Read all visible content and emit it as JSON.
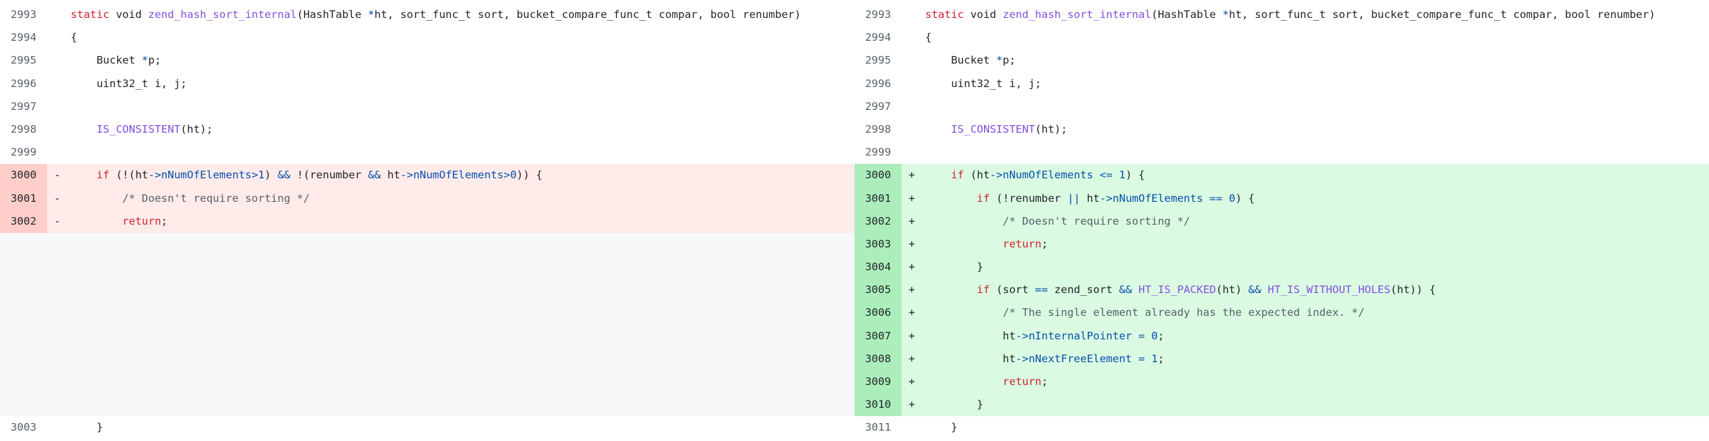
{
  "diff": {
    "left": [
      {
        "kind": "normal",
        "num": "2993",
        "mark": "",
        "tokens": [
          [
            "kw",
            "static"
          ],
          [
            "pl",
            " void "
          ],
          [
            "fn",
            "zend_hash_sort_internal"
          ],
          [
            "pl",
            "(HashTable "
          ],
          [
            "op",
            "*"
          ],
          [
            "pl",
            "ht, sort_func_t sort, bucket_compare_func_t compar, bool renumber)"
          ]
        ]
      },
      {
        "kind": "normal",
        "num": "2994",
        "mark": "",
        "tokens": [
          [
            "pl",
            "{"
          ]
        ]
      },
      {
        "kind": "normal",
        "num": "2995",
        "mark": "",
        "tokens": [
          [
            "pl",
            "    Bucket "
          ],
          [
            "op",
            "*"
          ],
          [
            "pl",
            "p;"
          ]
        ]
      },
      {
        "kind": "normal",
        "num": "2996",
        "mark": "",
        "tokens": [
          [
            "pl",
            "    uint32_t i, j;"
          ]
        ]
      },
      {
        "kind": "normal",
        "num": "2997",
        "mark": "",
        "tokens": []
      },
      {
        "kind": "normal",
        "num": "2998",
        "mark": "",
        "tokens": [
          [
            "pl",
            "    "
          ],
          [
            "mac",
            "IS_CONSISTENT"
          ],
          [
            "pl",
            "(ht);"
          ]
        ]
      },
      {
        "kind": "normal",
        "num": "2999",
        "mark": "",
        "tokens": []
      },
      {
        "kind": "del",
        "num": "3000",
        "mark": "-",
        "tokens": [
          [
            "pl",
            "    "
          ],
          [
            "kw",
            "if"
          ],
          [
            "pl",
            " (!(ht"
          ],
          [
            "op",
            "->"
          ],
          [
            "field",
            "nNumOfElements"
          ],
          [
            "op",
            ">"
          ],
          [
            "num",
            "1"
          ],
          [
            "pl",
            ") "
          ],
          [
            "op",
            "&&"
          ],
          [
            "pl",
            " !(renumber "
          ],
          [
            "op",
            "&&"
          ],
          [
            "pl",
            " ht"
          ],
          [
            "op",
            "->"
          ],
          [
            "field",
            "nNumOfElements"
          ],
          [
            "op",
            ">"
          ],
          [
            "num",
            "0"
          ],
          [
            "pl",
            ")) {"
          ]
        ]
      },
      {
        "kind": "del",
        "num": "3001",
        "mark": "-",
        "tokens": [
          [
            "pl",
            "        "
          ],
          [
            "cm",
            "/* Doesn't require sorting */"
          ]
        ]
      },
      {
        "kind": "del",
        "num": "3002",
        "mark": "-",
        "tokens": [
          [
            "pl",
            "        "
          ],
          [
            "kw",
            "return"
          ],
          [
            "pl",
            ";"
          ]
        ]
      },
      {
        "kind": "empty",
        "num": "",
        "mark": "",
        "tokens": []
      },
      {
        "kind": "empty",
        "num": "",
        "mark": "",
        "tokens": []
      },
      {
        "kind": "empty",
        "num": "",
        "mark": "",
        "tokens": []
      },
      {
        "kind": "empty",
        "num": "",
        "mark": "",
        "tokens": []
      },
      {
        "kind": "empty",
        "num": "",
        "mark": "",
        "tokens": []
      },
      {
        "kind": "empty",
        "num": "",
        "mark": "",
        "tokens": []
      },
      {
        "kind": "empty",
        "num": "",
        "mark": "",
        "tokens": []
      },
      {
        "kind": "empty",
        "num": "",
        "mark": "",
        "tokens": []
      },
      {
        "kind": "normal",
        "num": "3003",
        "mark": "",
        "tokens": [
          [
            "pl",
            "    }"
          ]
        ]
      }
    ],
    "right": [
      {
        "kind": "normal",
        "num": "2993",
        "mark": "",
        "tokens": [
          [
            "kw",
            "static"
          ],
          [
            "pl",
            " void "
          ],
          [
            "fn",
            "zend_hash_sort_internal"
          ],
          [
            "pl",
            "(HashTable "
          ],
          [
            "op",
            "*"
          ],
          [
            "pl",
            "ht, sort_func_t sort, bucket_compare_func_t compar, bool renumber)"
          ]
        ]
      },
      {
        "kind": "normal",
        "num": "2994",
        "mark": "",
        "tokens": [
          [
            "pl",
            "{"
          ]
        ]
      },
      {
        "kind": "normal",
        "num": "2995",
        "mark": "",
        "tokens": [
          [
            "pl",
            "    Bucket "
          ],
          [
            "op",
            "*"
          ],
          [
            "pl",
            "p;"
          ]
        ]
      },
      {
        "kind": "normal",
        "num": "2996",
        "mark": "",
        "tokens": [
          [
            "pl",
            "    uint32_t i, j;"
          ]
        ]
      },
      {
        "kind": "normal",
        "num": "2997",
        "mark": "",
        "tokens": []
      },
      {
        "kind": "normal",
        "num": "2998",
        "mark": "",
        "tokens": [
          [
            "pl",
            "    "
          ],
          [
            "mac",
            "IS_CONSISTENT"
          ],
          [
            "pl",
            "(ht);"
          ]
        ]
      },
      {
        "kind": "normal",
        "num": "2999",
        "mark": "",
        "tokens": []
      },
      {
        "kind": "add",
        "num": "3000",
        "mark": "+",
        "tokens": [
          [
            "pl",
            "    "
          ],
          [
            "kw",
            "if"
          ],
          [
            "pl",
            " (ht"
          ],
          [
            "op",
            "->"
          ],
          [
            "field",
            "nNumOfElements"
          ],
          [
            "pl",
            " "
          ],
          [
            "op",
            "<="
          ],
          [
            "pl",
            " "
          ],
          [
            "num",
            "1"
          ],
          [
            "pl",
            ") {"
          ]
        ]
      },
      {
        "kind": "add",
        "num": "3001",
        "mark": "+",
        "tokens": [
          [
            "pl",
            "        "
          ],
          [
            "kw",
            "if"
          ],
          [
            "pl",
            " (!renumber "
          ],
          [
            "op",
            "||"
          ],
          [
            "pl",
            " ht"
          ],
          [
            "op",
            "->"
          ],
          [
            "field",
            "nNumOfElements"
          ],
          [
            "pl",
            " "
          ],
          [
            "op",
            "=="
          ],
          [
            "pl",
            " "
          ],
          [
            "num",
            "0"
          ],
          [
            "pl",
            ") {"
          ]
        ]
      },
      {
        "kind": "add",
        "num": "3002",
        "mark": "+",
        "tokens": [
          [
            "pl",
            "            "
          ],
          [
            "cm",
            "/* Doesn't require sorting */"
          ]
        ]
      },
      {
        "kind": "add",
        "num": "3003",
        "mark": "+",
        "tokens": [
          [
            "pl",
            "            "
          ],
          [
            "kw",
            "return"
          ],
          [
            "pl",
            ";"
          ]
        ]
      },
      {
        "kind": "add",
        "num": "3004",
        "mark": "+",
        "tokens": [
          [
            "pl",
            "        }"
          ]
        ]
      },
      {
        "kind": "add",
        "num": "3005",
        "mark": "+",
        "tokens": [
          [
            "pl",
            "        "
          ],
          [
            "kw",
            "if"
          ],
          [
            "pl",
            " (sort "
          ],
          [
            "op",
            "=="
          ],
          [
            "pl",
            " zend_sort "
          ],
          [
            "op",
            "&&"
          ],
          [
            "pl",
            " "
          ],
          [
            "mac",
            "HT_IS_PACKED"
          ],
          [
            "pl",
            "(ht) "
          ],
          [
            "op",
            "&&"
          ],
          [
            "pl",
            " "
          ],
          [
            "mac",
            "HT_IS_WITHOUT_HOLES"
          ],
          [
            "pl",
            "(ht)) {"
          ]
        ]
      },
      {
        "kind": "add",
        "num": "3006",
        "mark": "+",
        "tokens": [
          [
            "pl",
            "            "
          ],
          [
            "cm",
            "/* The single element already has the expected index. */"
          ]
        ]
      },
      {
        "kind": "add",
        "num": "3007",
        "mark": "+",
        "tokens": [
          [
            "pl",
            "            ht"
          ],
          [
            "op",
            "->"
          ],
          [
            "field",
            "nInternalPointer"
          ],
          [
            "pl",
            " "
          ],
          [
            "op",
            "="
          ],
          [
            "pl",
            " "
          ],
          [
            "num",
            "0"
          ],
          [
            "pl",
            ";"
          ]
        ]
      },
      {
        "kind": "add",
        "num": "3008",
        "mark": "+",
        "tokens": [
          [
            "pl",
            "            ht"
          ],
          [
            "op",
            "->"
          ],
          [
            "field",
            "nNextFreeElement"
          ],
          [
            "pl",
            " "
          ],
          [
            "op",
            "="
          ],
          [
            "pl",
            " "
          ],
          [
            "num",
            "1"
          ],
          [
            "pl",
            ";"
          ]
        ]
      },
      {
        "kind": "add",
        "num": "3009",
        "mark": "+",
        "tokens": [
          [
            "pl",
            "            "
          ],
          [
            "kw",
            "return"
          ],
          [
            "pl",
            ";"
          ]
        ]
      },
      {
        "kind": "add",
        "num": "3010",
        "mark": "+",
        "tokens": [
          [
            "pl",
            "        }"
          ]
        ]
      },
      {
        "kind": "normal",
        "num": "3011",
        "mark": "",
        "tokens": [
          [
            "pl",
            "    }"
          ]
        ]
      }
    ]
  }
}
